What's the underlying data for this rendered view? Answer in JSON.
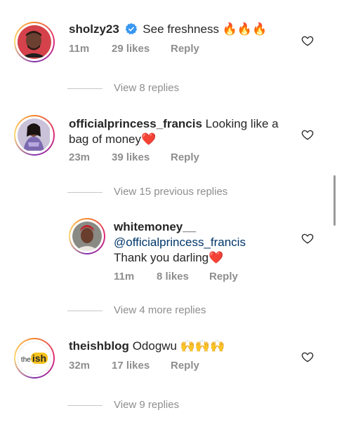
{
  "comments": [
    {
      "username": "sholzy23",
      "verified": true,
      "text": "See freshness 🔥🔥🔥",
      "time": "11m",
      "likes": "29 likes",
      "reply": "Reply",
      "view_replies": "View 8 replies"
    },
    {
      "username": "officialprincess_francis",
      "verified": false,
      "text_line1": "Looking like a",
      "text_line2": "bag of money❤️",
      "time": "23m",
      "likes": "39 likes",
      "reply": "Reply",
      "view_replies": "View 15 previous replies"
    },
    {
      "username": "theishblog",
      "verified": false,
      "text": "Odogwu 🙌🙌🙌",
      "time": "32m",
      "likes": "17 likes",
      "reply": "Reply",
      "view_replies": "View 9 replies",
      "avatar_text_1": "the",
      "avatar_text_2": "ish"
    }
  ],
  "reply": {
    "username": "whitemoney__",
    "mention": "@officialprincess_francis",
    "text": "Thank you darling❤️",
    "time": "11m",
    "likes": "8 likes",
    "reply": "Reply",
    "view_more": "View 4 more replies"
  },
  "colors": {
    "text": "#262626",
    "meta": "#8e8e8e",
    "mention": "#00376b",
    "verified": "#3897f0",
    "heart": "#e0245e"
  },
  "icons": [
    "verified-badge-icon",
    "heart-outline-icon"
  ]
}
